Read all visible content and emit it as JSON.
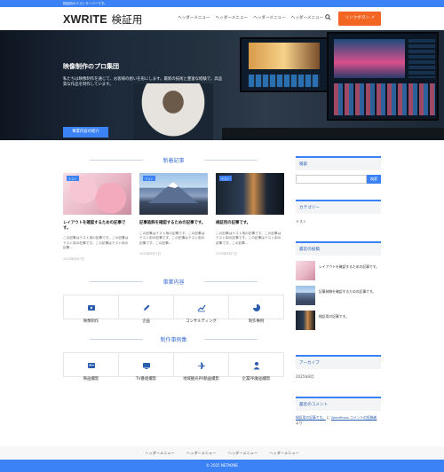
{
  "topbar": {
    "text": "検証用のテストサーバーです。"
  },
  "header": {
    "logo_main": "XWRITE",
    "logo_sub": "検証用",
    "nav": [
      "ヘッダーメニュー",
      "ヘッダーメニュー",
      "ヘッダーメニュー",
      "ヘッダーメニュー"
    ],
    "cta_label": "リンクボタン ↗"
  },
  "hero": {
    "title": "映像制作のプロ集団",
    "description": "私たちは映像制作を通じて、お客様の想いを形にします。最新の技術と豊富な経験で、高品質な作品を制作しています。",
    "button_label": "事業内容の紹介"
  },
  "sections": {
    "news": "新着記事",
    "business": "事業内容",
    "works": "制作事例集"
  },
  "posts": [
    {
      "tag": "テスト",
      "title": "レイアウトを確認するための記事です。",
      "excerpt": "この記事はテスト用の記事です。この記事はテスト用の記事です。この記事はテスト用の記事…",
      "date": "2025年8月7日"
    },
    {
      "tag": "テスト",
      "title": "記事装飾を確認するための記事です。",
      "excerpt": "この記事はテスト用の記事です。この記事はテスト用の記事です。この記事はテスト用の記事です。この記事…",
      "date": "2025年8月7日"
    },
    {
      "tag": "テスト",
      "title": "検証用の記事です。",
      "excerpt": "この記事はテスト用の記事です。この記事はテスト用の記事です。この記事はテスト用の記事です。この記事…",
      "date": "2025年8月7日"
    }
  ],
  "business": [
    "映像制作",
    "企画",
    "コンサルティング",
    "制作事例"
  ],
  "works": [
    "映画撮影",
    "TV番組撮影",
    "地域観光PR動画撮影",
    "企業PR動画撮影"
  ],
  "sidebar": {
    "search_title": "検索",
    "search_button": "検索",
    "category_title": "カテゴリー",
    "category_item": "テスト",
    "recent_title": "最近の投稿",
    "recent": [
      "レイアウトを確認するための記事です。",
      "記事装飾を確認するための記事です。",
      "検証用の記事です。"
    ],
    "archive_title": "アーカイブ",
    "archive_item": "2025年8月",
    "comments_title": "最近のコメント",
    "comment_link": "検証用の記事です。",
    "comment_mid": " に ",
    "comment_author": "WordPress コメントの投稿者",
    "comment_end": " より"
  },
  "footer": {
    "nav": [
      "ヘッダーメニュー",
      "ヘッダーメニュー",
      "ヘッダーメニュー",
      "ヘッダーメニュー"
    ],
    "copyright": "© 2025 NETAONE"
  },
  "colors": {
    "accent": "#3b82f6",
    "cta": "#f26522"
  }
}
